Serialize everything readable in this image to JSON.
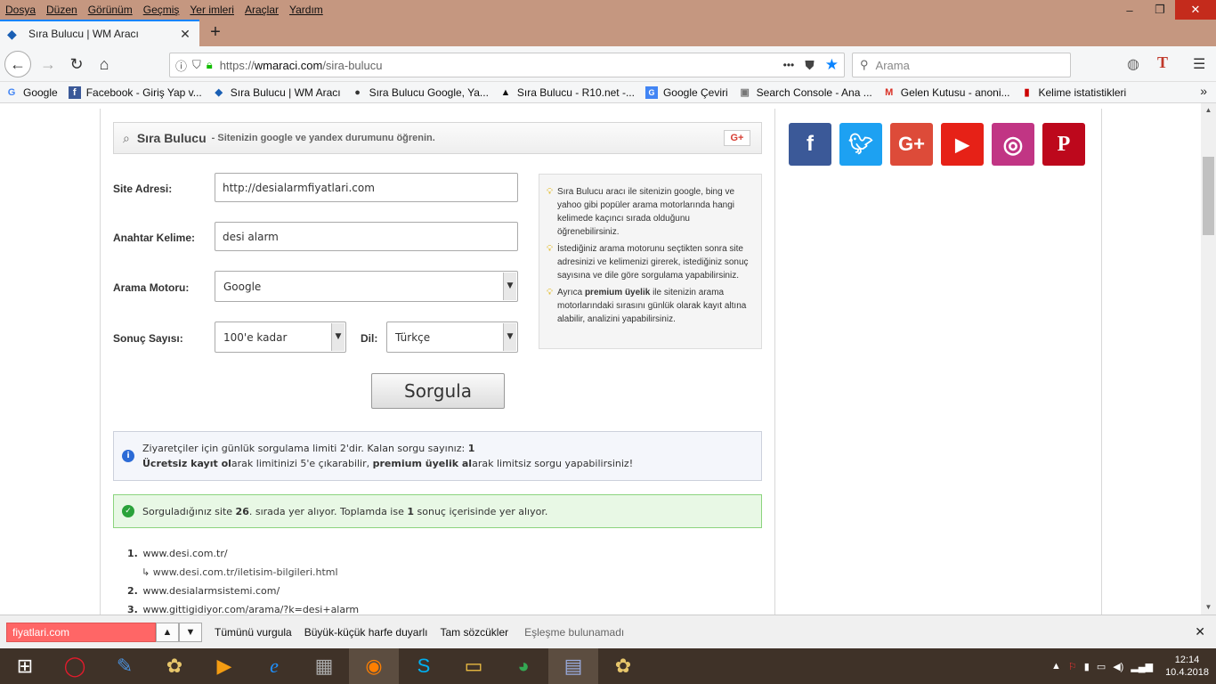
{
  "menu": [
    "Dosya",
    "Düzen",
    "Görünüm",
    "Geçmiş",
    "Yer imleri",
    "Araçlar",
    "Yardım"
  ],
  "window": {
    "minimize": "–",
    "maximize": "❐",
    "close": "✕"
  },
  "tab": {
    "title": "Sıra Bulucu | WM Aracı",
    "close": "✕",
    "new": "+"
  },
  "url": {
    "proto": "https://",
    "host": "wmaraci.com",
    "path": "/sira-bulucu",
    "more": "•••"
  },
  "search": {
    "placeholder": "Arama"
  },
  "bookmarks": [
    {
      "label": "Google",
      "icon": "G",
      "color": "#4285f4"
    },
    {
      "label": "Facebook - Giriş Yap v...",
      "icon": "f",
      "color": "#3b5998"
    },
    {
      "label": "Sıra Bulucu | WM Aracı",
      "icon": "W",
      "color": "#1a5fb4"
    },
    {
      "label": "Sıra Bulucu Google, Ya...",
      "icon": "●",
      "color": "#333"
    },
    {
      "label": "Sıra Bulucu - R10.net -...",
      "icon": "A",
      "color": "#111"
    },
    {
      "label": "Google Çeviri",
      "icon": "G",
      "color": "#4285f4"
    },
    {
      "label": "Search Console - Ana ...",
      "icon": "S",
      "color": "#777"
    },
    {
      "label": "Gelen Kutusu - anoni...",
      "icon": "M",
      "color": "#d93025"
    },
    {
      "label": "Kelime istatistikleri",
      "icon": "▮",
      "color": "#c00"
    }
  ],
  "tool": {
    "title": "Sıra Bulucu",
    "subtitle": "- Sitenizin google ve yandex durumunu öğrenin.",
    "gplus": "G+",
    "site_label": "Site Adresi:",
    "site_value": "http://desialarmfiyatlari.com",
    "keyword_label": "Anahtar Kelime:",
    "keyword_value": "desi alarm",
    "engine_label": "Arama Motoru:",
    "engine_value": "Google",
    "count_label": "Sonuç Sayısı:",
    "count_value": "100'e kadar",
    "lang_label": "Dil:",
    "lang_value": "Türkçe",
    "submit": "Sorgula"
  },
  "info": [
    {
      "pre": "Sıra Bulucu aracı ile sitenizin google, bing ve yahoo gibi popüler arama motorlarında hangi kelimede kaçıncı sırada olduğunu öğrenebilirsiniz.",
      "bold": "",
      "post": ""
    },
    {
      "pre": "İstediğiniz arama motorunu seçtikten sonra site adresinizi ve kelimenizi girerek, istediğiniz sonuç sayısına ve dile göre sorgulama yapabilirsiniz.",
      "bold": "",
      "post": ""
    },
    {
      "pre": "Ayrıca ",
      "bold": "premium üyelik",
      "post": " ile sitenizin arama motorlarındaki sırasını günlük olarak kayıt altına alabilir, analizini yapabilirsiniz."
    }
  ],
  "limit": {
    "l1": "Ziyaretçiler için günlük sorgulama limiti 2'dir. Kalan sorgu sayınız: ",
    "remaining": "1",
    "b1": "Ücretsiz kayıt ol",
    "t1": "arak limitinizi 5'e çıkarabilir, ",
    "b2": "premium üyelik al",
    "t2": "arak limitsiz sorgu yapabilirsiniz!"
  },
  "result_msg": {
    "a": "Sorguladığınız site ",
    "rank": "26",
    "b": ". sırada yer alıyor. Toplamda ise ",
    "total": "1",
    "c": " sonuç içerisinde yer alıyor."
  },
  "results": [
    {
      "n": "1.",
      "url": "www.desi.com.tr/"
    },
    {
      "sub": "↳ www.desi.com.tr/iletisim-bilgileri.html"
    },
    {
      "n": "2.",
      "url": "www.desialarmsistemi.com/"
    },
    {
      "n": "3.",
      "url": "www.gittigidiyor.com/arama/?k=desi+alarm"
    }
  ],
  "social": [
    {
      "name": "facebook",
      "glyph": "f",
      "color": "#3b5998"
    },
    {
      "name": "twitter",
      "glyph": "🐦",
      "color": "#1da1f2"
    },
    {
      "name": "google-plus",
      "glyph": "G+",
      "color": "#dd4b39"
    },
    {
      "name": "youtube",
      "glyph": "▶",
      "color": "#e62117"
    },
    {
      "name": "instagram",
      "glyph": "◎",
      "color": "#c13584"
    },
    {
      "name": "pinterest",
      "glyph": "P",
      "color": "#bd081c"
    }
  ],
  "find": {
    "value": "fiyatlari.com",
    "highlight_all": "Tümünü vurgula",
    "match_case": "Büyük-küçük harfe duyarlı",
    "whole_words": "Tam sözcükler",
    "status": "Eşleşme bulunamadı"
  },
  "clock": {
    "time": "12:14",
    "date": "10.4.2018"
  },
  "colors": {
    "accent": "#0a84ff",
    "find_error": "#ff6666",
    "success_border": "#8bd47e"
  }
}
